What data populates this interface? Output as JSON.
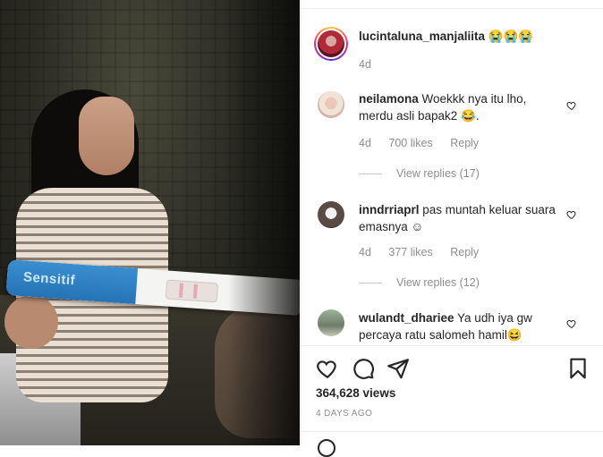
{
  "post": {
    "caption_user": "lucintaluna_manjaliita",
    "caption_emoji": "😭😭😭",
    "caption_time": "4d"
  },
  "media": {
    "test_brand": "Sensitif"
  },
  "comments": [
    {
      "username": "neilamona",
      "text": "Woekkk nya itu lho, merdu asli bapak2 😂.",
      "time": "4d",
      "likes": "700 likes",
      "reply_label": "Reply",
      "view_replies": "View replies (17)"
    },
    {
      "username": "inndrriaprl",
      "text": "pas muntah keluar suara emasnya ☺",
      "time": "4d",
      "likes": "377 likes",
      "reply_label": "Reply",
      "view_replies": "View replies (12)"
    },
    {
      "username": "wulandt_dhariee",
      "text": "Ya udh iya gw percaya ratu salomeh hamil😆"
    }
  ],
  "footer": {
    "views": "364,628 views",
    "posted": "4 DAYS AGO"
  },
  "icons": {
    "like": "heart-icon",
    "comment": "comment-icon",
    "share": "paper-plane-icon",
    "save": "bookmark-icon"
  }
}
